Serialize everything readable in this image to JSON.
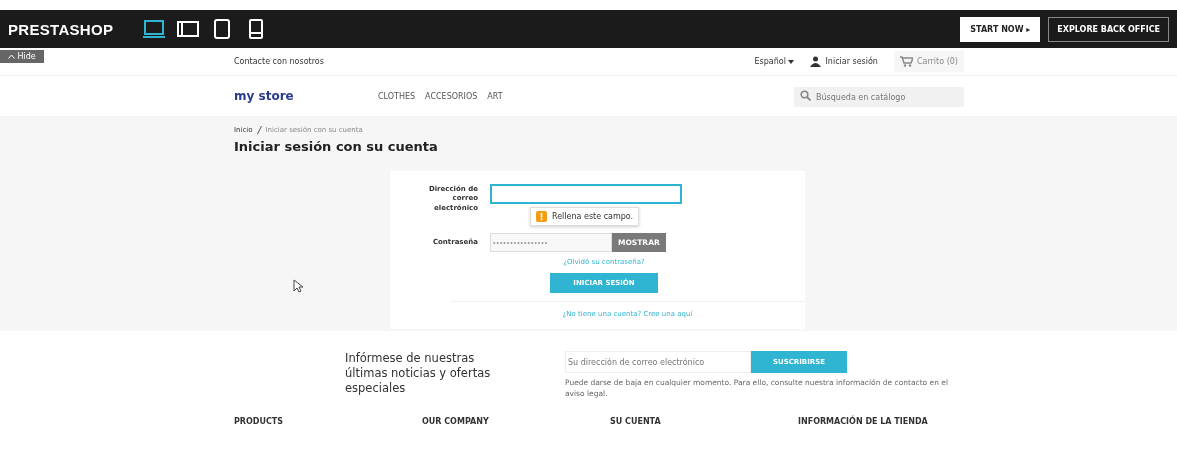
{
  "topbar": {
    "brand": "PRESTASHOP",
    "devices": [
      {
        "kind": "laptop",
        "selected": true
      },
      {
        "kind": "tablet-landscape",
        "selected": false
      },
      {
        "kind": "tablet",
        "selected": false
      },
      {
        "kind": "phone",
        "selected": false
      }
    ],
    "start_button": "START NOW ▸",
    "explore_button": "EXPLORE BACK OFFICE"
  },
  "hide_button": "Hide",
  "nav": {
    "contact": "Contacte con nosotros",
    "language": "Español",
    "login": "Iniciar sesión",
    "cart": "Carrito (0)"
  },
  "header": {
    "logo": "my store",
    "menu": [
      "CLOTHES",
      "ACCESORIOS",
      "ART"
    ],
    "search": {
      "placeholder": "Búsqueda en catálogo"
    }
  },
  "breadcrumb": [
    "Inicio",
    "Iniciar sesión con su cuenta"
  ],
  "page_title": "Iniciar sesión con su cuenta",
  "form": {
    "email_label": "Dirección de correo electrónico",
    "tooltip": "Rellena este campo.",
    "password_label": "Contraseña",
    "password_value": "••••••••••••••••",
    "show_button": "MOSTRAR",
    "forgot_link": "¿Olvidó su contraseña?",
    "submit_button": "INICIAR SESIÓN",
    "register_link": "¿No tiene una cuenta? Cree una aquí"
  },
  "newsletter": {
    "heading": "Infórmese de nuestras últimas noticias y ofertas especiales",
    "placeholder": "Su dirección de correo electrónico",
    "button": "SUSCRIBIRSE",
    "note": "Puede darse de baja en cualquier momento. Para ello, consulte nuestra información de contacto en el aviso legal."
  },
  "footer_columns": [
    "PRODUCTS",
    "OUR COMPANY",
    "SU CUENTA",
    "INFORMACIÓN DE LA TIENDA"
  ]
}
